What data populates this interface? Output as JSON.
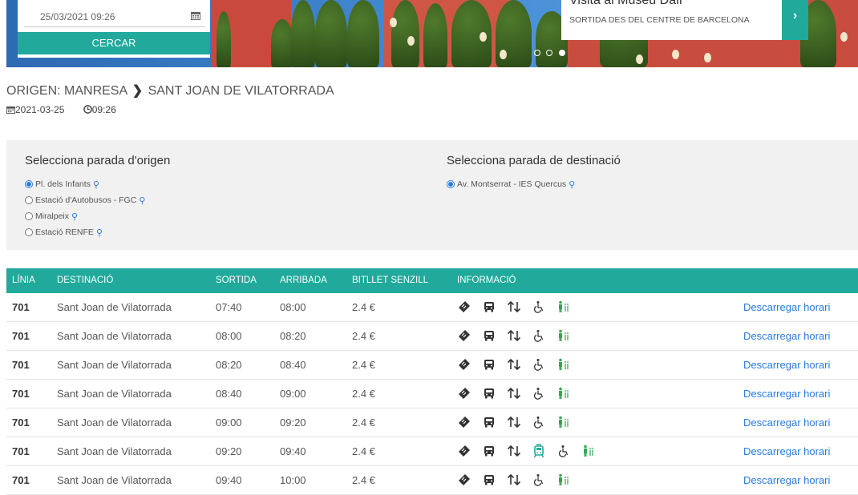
{
  "search": {
    "datetime": "25/03/2021 09:26",
    "button": "CERCAR"
  },
  "promo": {
    "title": "Visita al Museu Dalí",
    "subtitle": "SORTIDA DES DEL CENTRE DE BARCELONA",
    "next": "›"
  },
  "carousel": {
    "count": 3,
    "active": 2
  },
  "route": {
    "prefix": "ORIGEN:",
    "origin": "MANRESA",
    "arrow": "❯",
    "destination": "SANT JOAN DE VILATORRADA"
  },
  "meta": {
    "date": "2021-03-25",
    "time": "09:26"
  },
  "origin_panel": {
    "title": "Selecciona parada d'origen",
    "stops": [
      {
        "label": "Pl. dels Infants",
        "selected": true
      },
      {
        "label": "Estació d'Autobusos - FGC",
        "selected": false
      },
      {
        "label": "Miralpeix",
        "selected": false
      },
      {
        "label": "Estació RENFE",
        "selected": false
      }
    ]
  },
  "dest_panel": {
    "title": "Selecciona parada de destinació",
    "stops": [
      {
        "label": "Av. Montserrat - IES Quercus",
        "selected": true
      }
    ]
  },
  "table": {
    "headers": {
      "line": "LÍNIA",
      "dest": "DESTINACIÓ",
      "dep": "SORTIDA",
      "arr": "ARRIBADA",
      "ticket": "BITLLET SENZILL",
      "info": "INFORMACIÓ"
    },
    "rows": [
      {
        "line": "701",
        "dest": "Sant Joan de Vilatorrada",
        "dep": "07:40",
        "arr": "08:00",
        "price": "2.4 €",
        "extra_icon": false,
        "link": "Descarregar horari"
      },
      {
        "line": "701",
        "dest": "Sant Joan de Vilatorrada",
        "dep": "08:00",
        "arr": "08:20",
        "price": "2.4 €",
        "extra_icon": false,
        "link": "Descarregar horari"
      },
      {
        "line": "701",
        "dest": "Sant Joan de Vilatorrada",
        "dep": "08:20",
        "arr": "08:40",
        "price": "2.4 €",
        "extra_icon": false,
        "link": "Descarregar horari"
      },
      {
        "line": "701",
        "dest": "Sant Joan de Vilatorrada",
        "dep": "08:40",
        "arr": "09:00",
        "price": "2.4 €",
        "extra_icon": false,
        "link": "Descarregar horari"
      },
      {
        "line": "701",
        "dest": "Sant Joan de Vilatorrada",
        "dep": "09:00",
        "arr": "09:20",
        "price": "2.4 €",
        "extra_icon": false,
        "link": "Descarregar horari"
      },
      {
        "line": "701",
        "dest": "Sant Joan de Vilatorrada",
        "dep": "09:20",
        "arr": "09:40",
        "price": "2.4 €",
        "extra_icon": true,
        "link": "Descarregar horari"
      },
      {
        "line": "701",
        "dest": "Sant Joan de Vilatorrada",
        "dep": "09:40",
        "arr": "10:00",
        "price": "2.4 €",
        "extra_icon": false,
        "link": "Descarregar horari"
      }
    ],
    "info_icons": [
      "ticket-icon",
      "bus-icon",
      "transfer-icon",
      "accessible-icon",
      "family-icon"
    ],
    "extra_info_icon": "tram-icon"
  },
  "colors": {
    "accent": "#21a99b",
    "link": "#2a7be0",
    "panel": "#f1f1f1",
    "green": "#2fa84f"
  }
}
